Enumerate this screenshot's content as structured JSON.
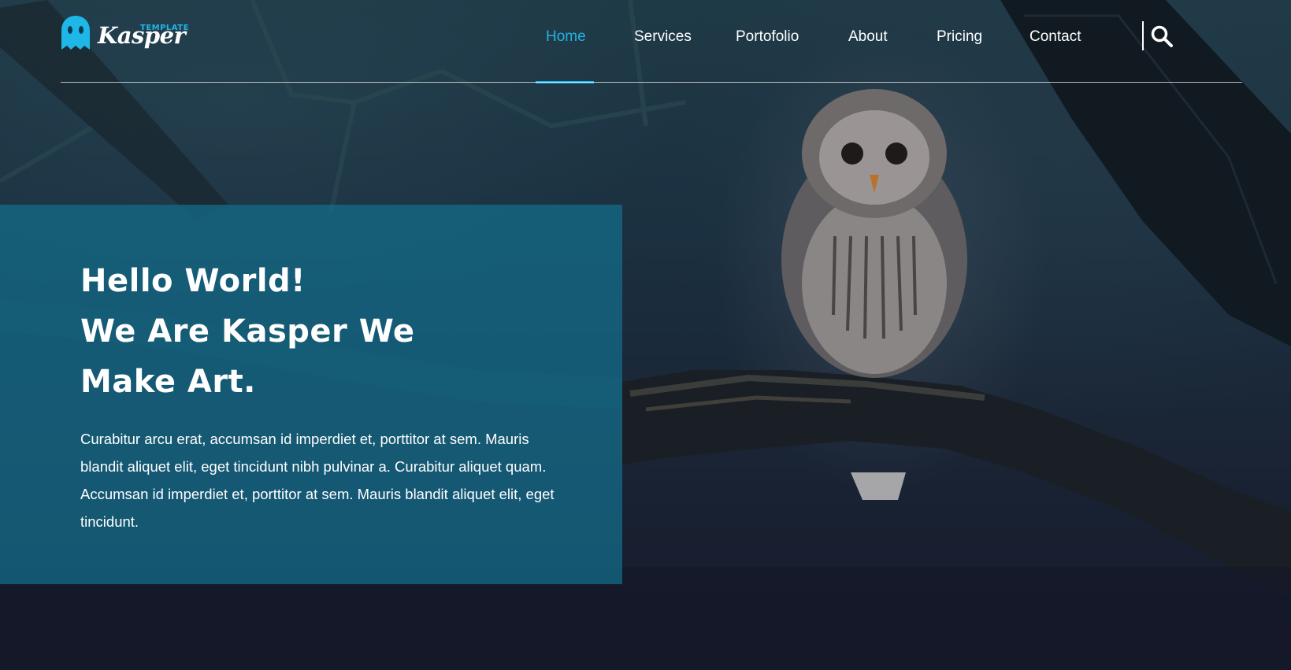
{
  "logo": {
    "small_text": "TEMPLATE",
    "brand": "Kasper",
    "ghost_icon": "ghost-icon"
  },
  "nav": {
    "items": [
      {
        "label": "Home",
        "active": true
      },
      {
        "label": "Services",
        "active": false
      },
      {
        "label": "Portofolio",
        "active": false
      },
      {
        "label": "About",
        "active": false
      },
      {
        "label": "Pricing",
        "active": false
      },
      {
        "label": "Contact",
        "active": false
      }
    ],
    "search_icon": "search-icon"
  },
  "hero": {
    "headline_lines": [
      "Hello World!",
      "We Are Kasper We",
      "Make Art."
    ],
    "body_lines": [
      "Curabitur arcu erat, accumsan id imperdiet et, porttitor at sem. Mauris",
      "blandit aliquet elit, eget tincidunt nibh pulvinar a. Curabitur aliquet quam.",
      "Accumsan id imperdiet et, porttitor at sem. Mauris blandit aliquet elit, eget",
      "tincidunt."
    ]
  },
  "colors": {
    "accent": "#1fb7e8",
    "panel": "#146e8c",
    "text": "#ffffff"
  }
}
